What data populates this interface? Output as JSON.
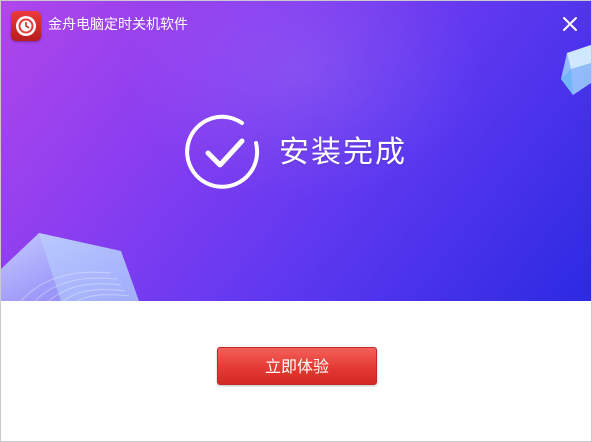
{
  "app": {
    "title": "金舟电脑定时关机软件",
    "logo_icon": "clock-icon"
  },
  "window_controls": {
    "close_icon": "close-icon"
  },
  "status": {
    "icon": "check-circle-icon",
    "text": "安装完成"
  },
  "action": {
    "label": "立即体验"
  },
  "colors": {
    "banner_start": "#b046ea",
    "banner_end": "#2b2ae2",
    "button": "#e43a33",
    "logo": "#d62b2b"
  }
}
